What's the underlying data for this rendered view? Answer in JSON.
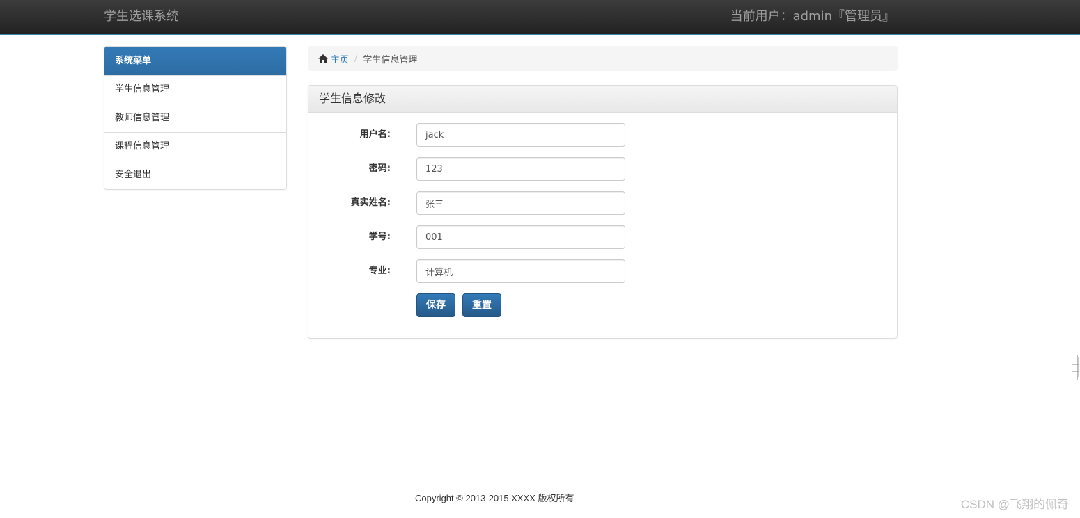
{
  "header": {
    "brand": "学生选课系统",
    "user_info": "当前用户：admin『管理员』"
  },
  "sidebar": {
    "heading": "系统菜单",
    "items": [
      {
        "label": "学生信息管理"
      },
      {
        "label": "教师信息管理"
      },
      {
        "label": "课程信息管理"
      },
      {
        "label": "安全退出"
      }
    ]
  },
  "breadcrumb": {
    "home_icon": "home-icon",
    "home": "主页",
    "separator": "/",
    "current": "学生信息管理"
  },
  "panel": {
    "title": "学生信息修改",
    "fields": [
      {
        "label": "用户名:",
        "value": "jack"
      },
      {
        "label": "密码:",
        "value": "123"
      },
      {
        "label": "真实姓名:",
        "value": "张三"
      },
      {
        "label": "学号:",
        "value": "001"
      },
      {
        "label": "专业:",
        "value": "计算机"
      }
    ],
    "save_label": "保存",
    "reset_label": "重置"
  },
  "footer": {
    "copyright": "Copyright © 2013-2015 XXXX 版权所有"
  },
  "watermark": "CSDN @飞翔的佩奇",
  "colors": {
    "navbar": "#222222",
    "primary": "#337ab7",
    "link": "#337ab7"
  }
}
